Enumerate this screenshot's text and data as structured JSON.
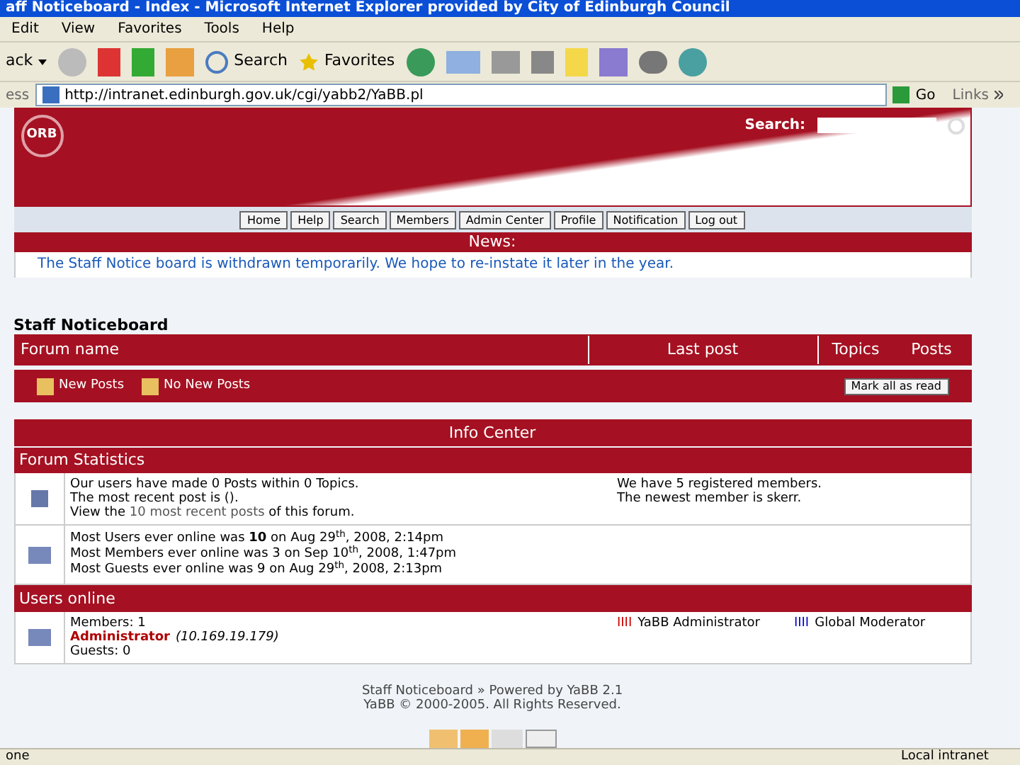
{
  "window": {
    "title": "aff Noticeboard - Index - Microsoft Internet Explorer provided by City of Edinburgh Council"
  },
  "menu": [
    "Edit",
    "View",
    "Favorites",
    "Tools",
    "Help"
  ],
  "toolbar": {
    "back": "ack",
    "search": "Search",
    "favorites": "Favorites"
  },
  "address": {
    "label": "ess",
    "url": "http://intranet.edinburgh.gov.uk/cgi/yabb2/YaBB.pl",
    "go": "Go",
    "links": "Links"
  },
  "header": {
    "logo": "ORB",
    "search_label": "Search:"
  },
  "nav": [
    "Home",
    "Help",
    "Search",
    "Members",
    "Admin Center",
    "Profile",
    "Notification",
    "Log out"
  ],
  "news": {
    "title": "News:",
    "text": "The Staff Notice board is withdrawn temporarily. We hope to re-instate it later in the year."
  },
  "board": {
    "title": "Staff Noticeboard",
    "columns": [
      "Forum name",
      "Last post",
      "Topics",
      "Posts"
    ],
    "legend": [
      "New Posts",
      "No New Posts"
    ],
    "mark_read": "Mark all as read"
  },
  "info_center": {
    "title": "Info Center",
    "stats_title": "Forum Statistics",
    "stats_left": [
      "Our users have made 0 Posts within 0 Topics.",
      "The most recent post is ()."
    ],
    "recent": {
      "before": "View the",
      "link": "10 most recent posts",
      "after": "of this forum."
    },
    "stats_right": [
      "We have 5 registered members.",
      "The newest member is skerr."
    ],
    "records": [
      "Most Users ever online was **10** on Aug 29$^{th}$, 2008, 2:14pm",
      "Most Members ever online was 3 on Sep 10$^{th}$, 2008, 1:47pm",
      "Most Guests ever online was 9 on Aug 29$^{th}$, 2008, 2:13pm"
    ],
    "online_title": "Users online",
    "members": "Members: 1",
    "admin_name": "Administrator",
    "admin_ip": "(10.169.19.179)",
    "guests": "Guests: 0",
    "groups": [
      {
        "mark": "IIII",
        "name": "YaBB Administrator",
        "color": "#cc0000"
      },
      {
        "mark": "IIII",
        "name": "Global Moderator",
        "color": "#0000cc"
      }
    ]
  },
  "footer": [
    "Staff Noticeboard » Powered by YaBB 2.1",
    "YaBB © 2000-2005. All Rights Reserved."
  ],
  "status_bar": {
    "left": "one",
    "zone": "Local intranet"
  }
}
